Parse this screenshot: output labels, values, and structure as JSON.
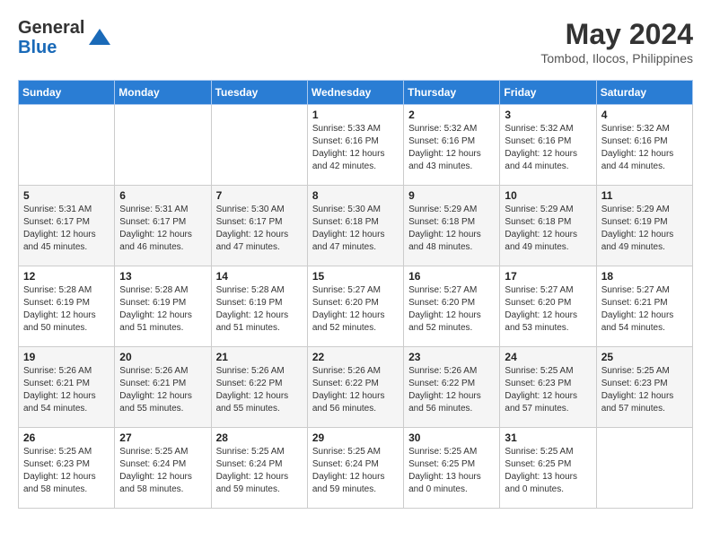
{
  "header": {
    "logo_general": "General",
    "logo_blue": "Blue",
    "month_year": "May 2024",
    "location": "Tombod, Ilocos, Philippines"
  },
  "weekdays": [
    "Sunday",
    "Monday",
    "Tuesday",
    "Wednesday",
    "Thursday",
    "Friday",
    "Saturday"
  ],
  "weeks": [
    {
      "days": [
        {
          "num": "",
          "sunrise": "",
          "sunset": "",
          "daylight": ""
        },
        {
          "num": "",
          "sunrise": "",
          "sunset": "",
          "daylight": ""
        },
        {
          "num": "",
          "sunrise": "",
          "sunset": "",
          "daylight": ""
        },
        {
          "num": "1",
          "sunrise": "5:33 AM",
          "sunset": "6:16 PM",
          "daylight": "12 hours and 42 minutes."
        },
        {
          "num": "2",
          "sunrise": "5:32 AM",
          "sunset": "6:16 PM",
          "daylight": "12 hours and 43 minutes."
        },
        {
          "num": "3",
          "sunrise": "5:32 AM",
          "sunset": "6:16 PM",
          "daylight": "12 hours and 44 minutes."
        },
        {
          "num": "4",
          "sunrise": "5:32 AM",
          "sunset": "6:16 PM",
          "daylight": "12 hours and 44 minutes."
        }
      ]
    },
    {
      "days": [
        {
          "num": "5",
          "sunrise": "5:31 AM",
          "sunset": "6:17 PM",
          "daylight": "12 hours and 45 minutes."
        },
        {
          "num": "6",
          "sunrise": "5:31 AM",
          "sunset": "6:17 PM",
          "daylight": "12 hours and 46 minutes."
        },
        {
          "num": "7",
          "sunrise": "5:30 AM",
          "sunset": "6:17 PM",
          "daylight": "12 hours and 47 minutes."
        },
        {
          "num": "8",
          "sunrise": "5:30 AM",
          "sunset": "6:18 PM",
          "daylight": "12 hours and 47 minutes."
        },
        {
          "num": "9",
          "sunrise": "5:29 AM",
          "sunset": "6:18 PM",
          "daylight": "12 hours and 48 minutes."
        },
        {
          "num": "10",
          "sunrise": "5:29 AM",
          "sunset": "6:18 PM",
          "daylight": "12 hours and 49 minutes."
        },
        {
          "num": "11",
          "sunrise": "5:29 AM",
          "sunset": "6:19 PM",
          "daylight": "12 hours and 49 minutes."
        }
      ]
    },
    {
      "days": [
        {
          "num": "12",
          "sunrise": "5:28 AM",
          "sunset": "6:19 PM",
          "daylight": "12 hours and 50 minutes."
        },
        {
          "num": "13",
          "sunrise": "5:28 AM",
          "sunset": "6:19 PM",
          "daylight": "12 hours and 51 minutes."
        },
        {
          "num": "14",
          "sunrise": "5:28 AM",
          "sunset": "6:19 PM",
          "daylight": "12 hours and 51 minutes."
        },
        {
          "num": "15",
          "sunrise": "5:27 AM",
          "sunset": "6:20 PM",
          "daylight": "12 hours and 52 minutes."
        },
        {
          "num": "16",
          "sunrise": "5:27 AM",
          "sunset": "6:20 PM",
          "daylight": "12 hours and 52 minutes."
        },
        {
          "num": "17",
          "sunrise": "5:27 AM",
          "sunset": "6:20 PM",
          "daylight": "12 hours and 53 minutes."
        },
        {
          "num": "18",
          "sunrise": "5:27 AM",
          "sunset": "6:21 PM",
          "daylight": "12 hours and 54 minutes."
        }
      ]
    },
    {
      "days": [
        {
          "num": "19",
          "sunrise": "5:26 AM",
          "sunset": "6:21 PM",
          "daylight": "12 hours and 54 minutes."
        },
        {
          "num": "20",
          "sunrise": "5:26 AM",
          "sunset": "6:21 PM",
          "daylight": "12 hours and 55 minutes."
        },
        {
          "num": "21",
          "sunrise": "5:26 AM",
          "sunset": "6:22 PM",
          "daylight": "12 hours and 55 minutes."
        },
        {
          "num": "22",
          "sunrise": "5:26 AM",
          "sunset": "6:22 PM",
          "daylight": "12 hours and 56 minutes."
        },
        {
          "num": "23",
          "sunrise": "5:26 AM",
          "sunset": "6:22 PM",
          "daylight": "12 hours and 56 minutes."
        },
        {
          "num": "24",
          "sunrise": "5:25 AM",
          "sunset": "6:23 PM",
          "daylight": "12 hours and 57 minutes."
        },
        {
          "num": "25",
          "sunrise": "5:25 AM",
          "sunset": "6:23 PM",
          "daylight": "12 hours and 57 minutes."
        }
      ]
    },
    {
      "days": [
        {
          "num": "26",
          "sunrise": "5:25 AM",
          "sunset": "6:23 PM",
          "daylight": "12 hours and 58 minutes."
        },
        {
          "num": "27",
          "sunrise": "5:25 AM",
          "sunset": "6:24 PM",
          "daylight": "12 hours and 58 minutes."
        },
        {
          "num": "28",
          "sunrise": "5:25 AM",
          "sunset": "6:24 PM",
          "daylight": "12 hours and 59 minutes."
        },
        {
          "num": "29",
          "sunrise": "5:25 AM",
          "sunset": "6:24 PM",
          "daylight": "12 hours and 59 minutes."
        },
        {
          "num": "30",
          "sunrise": "5:25 AM",
          "sunset": "6:25 PM",
          "daylight": "13 hours and 0 minutes."
        },
        {
          "num": "31",
          "sunrise": "5:25 AM",
          "sunset": "6:25 PM",
          "daylight": "13 hours and 0 minutes."
        },
        {
          "num": "",
          "sunrise": "",
          "sunset": "",
          "daylight": ""
        }
      ]
    }
  ]
}
